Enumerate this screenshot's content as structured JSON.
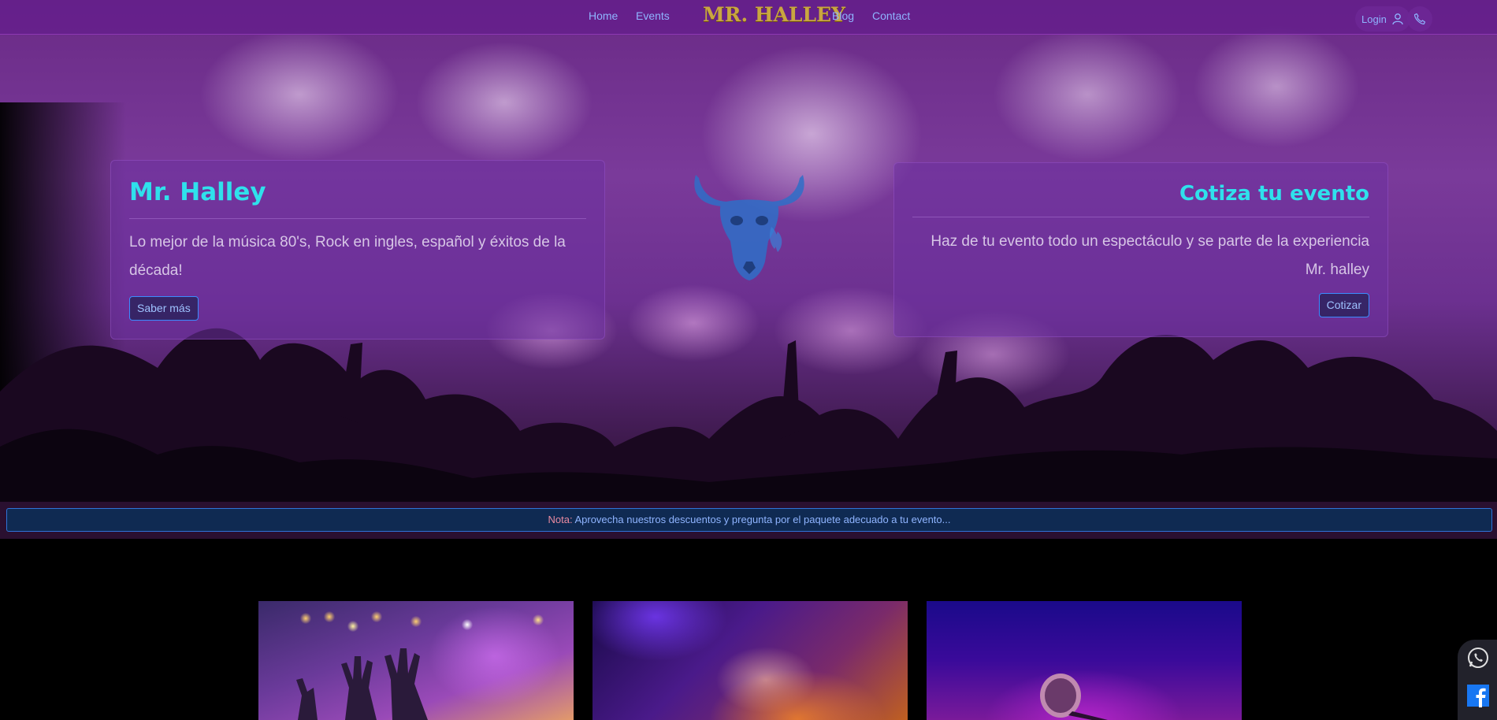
{
  "navbar": {
    "links": {
      "home": "Home",
      "events": "Events",
      "blog": "Blog",
      "contact": "Contact"
    },
    "logo_text": "MR. HALLEY",
    "login_label": "Login"
  },
  "hero": {
    "left_card": {
      "title": "Mr. Halley",
      "text": "Lo mejor de la música 80's, Rock en ingles, español y éxitos de la década!",
      "button": "Saber más"
    },
    "right_card": {
      "title": "Cotiza tu evento",
      "text": "Haz de tu evento todo un espectáculo y se parte de la experiencia Mr. halley",
      "button": "Cotizar"
    }
  },
  "note": {
    "label": "Nota:",
    "text": " Aprovecha nuestros descuentos y pregunta por el paquete adecuado a tu evento..."
  },
  "icons": {
    "user": "user-icon",
    "phone": "phone-icon",
    "whatsapp": "whatsapp-icon",
    "facebook": "facebook-icon",
    "skull": "bull-skull-icon"
  },
  "colors": {
    "accent_cyan": "#2fe1ec",
    "link_blue": "#8fb4ff",
    "logo_gold": "#c9a640",
    "button_border": "#3b8cff"
  }
}
